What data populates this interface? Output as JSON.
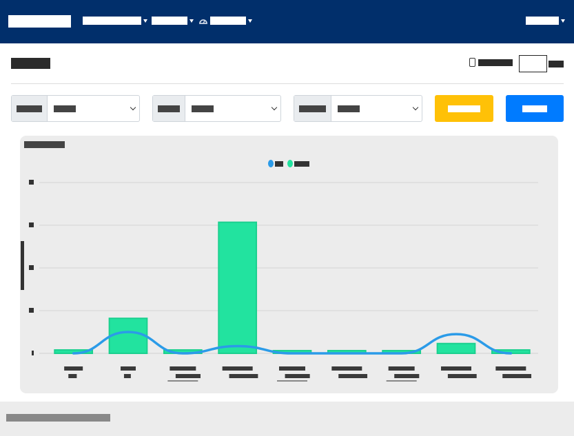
{
  "nav": {
    "brand": "",
    "items": [
      {
        "label": "",
        "has_caret": true
      },
      {
        "label": "",
        "has_caret": true
      },
      {
        "label": "",
        "has_caret": true,
        "icon": "dashboard-gauge-icon"
      }
    ],
    "user_menu": {
      "label": "",
      "has_caret": true
    }
  },
  "header": {
    "title": "",
    "auto_refresh_label": "",
    "interval_value": "",
    "interval_unit": ""
  },
  "filters": [
    {
      "addon": "",
      "value": ""
    },
    {
      "addon": "",
      "value": ""
    },
    {
      "addon": "",
      "value": ""
    }
  ],
  "buttons": {
    "warning_label": "",
    "primary_label": ""
  },
  "colors": {
    "nav_bg": "#012f6b",
    "bar": "#22e39f",
    "line": "#2b9be8",
    "warning": "#ffc107",
    "primary": "#007bff"
  },
  "chart_data": {
    "type": "bar",
    "title": "",
    "xlabel": "",
    "ylabel": "",
    "ylim": [
      0,
      4
    ],
    "grid": true,
    "legend_position": "top",
    "categories": [
      "",
      "",
      "",
      "",
      "",
      "",
      "",
      "",
      ""
    ],
    "series": [
      {
        "type": "bar",
        "values": [
          0.08,
          0.82,
          0.08,
          3.07,
          0.0,
          0.0,
          0.0,
          0.23,
          0.08
        ]
      },
      {
        "type": "line",
        "values": [
          0.0,
          0.5,
          0.0,
          0.17,
          0.0,
          0.0,
          0.0,
          0.45,
          0.0
        ]
      }
    ]
  },
  "footer": {
    "text": ""
  }
}
